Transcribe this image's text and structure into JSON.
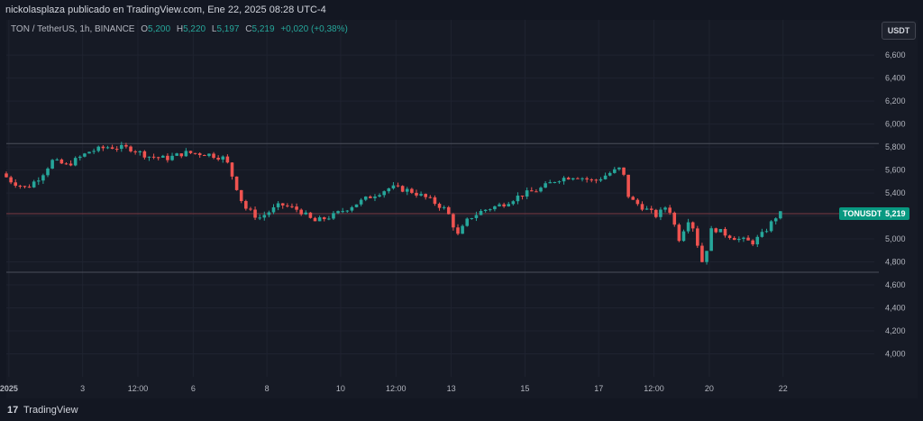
{
  "header": {
    "publisher_line": "nickolasplaza publicado en TradingView.com, Ene 22, 2025 08:28 UTC-4"
  },
  "legend": {
    "symbol": "TON / TetherUS, 1h, BINANCE",
    "open_label": "O",
    "open_value": "5,200",
    "high_label": "H",
    "high_value": "5,220",
    "low_label": "L",
    "low_value": "5,197",
    "close_label": "C",
    "close_value": "5,219",
    "change": "+0,020 (+0,38%)"
  },
  "toolbar": {
    "currency": "USDT"
  },
  "price_tag": {
    "symbol": "TONUSDT",
    "value": "5,219"
  },
  "footer": {
    "logo_text": "17",
    "brand": "TradingView"
  },
  "colors": {
    "up": "#26a69a",
    "down": "#ef5350",
    "background": "#161a25",
    "grid": "#1f2330",
    "axis_text": "#b2b5be",
    "tag": "#089981"
  },
  "chart_data": {
    "type": "candlestick",
    "y_ticks": [
      4.0,
      4.2,
      4.4,
      4.6,
      4.8,
      5.0,
      5.2,
      5.4,
      5.6,
      5.8,
      6.0,
      6.2,
      6.4,
      6.6
    ],
    "y_tick_labels": [
      "4,000",
      "4,200",
      "4,400",
      "4,600",
      "4,800",
      "5,000",
      "5,200",
      "5,400",
      "5,600",
      "5,800",
      "6,000",
      "6,200",
      "6,400",
      "6,600"
    ],
    "ylim": [
      3.8,
      6.75
    ],
    "x_ticks": [
      {
        "label": "2025",
        "day": 1.0
      },
      {
        "label": "3",
        "day": 3.0
      },
      {
        "label": "12:00",
        "day": 4.5
      },
      {
        "label": "6",
        "day": 6.0
      },
      {
        "label": "8",
        "day": 8.0
      },
      {
        "label": "10",
        "day": 10.0
      },
      {
        "label": "12:00",
        "day": 11.5
      },
      {
        "label": "13",
        "day": 13.0
      },
      {
        "label": "15",
        "day": 15.0
      },
      {
        "label": "17",
        "day": 17.0
      },
      {
        "label": "12:00",
        "day": 18.5
      },
      {
        "label": "20",
        "day": 20.0
      },
      {
        "label": "22",
        "day": 22.0
      }
    ],
    "xlim": [
      0.93,
      23.45
    ],
    "horizontal_lines": [
      5.83,
      5.22,
      4.71
    ],
    "current_price": 5.219,
    "path_keypoints": [
      [
        0.93,
        5.57
      ],
      [
        1.2,
        5.5
      ],
      [
        1.6,
        5.44
      ],
      [
        2.0,
        5.55
      ],
      [
        2.3,
        5.68
      ],
      [
        2.7,
        5.64
      ],
      [
        3.3,
        5.76
      ],
      [
        3.8,
        5.8
      ],
      [
        4.4,
        5.79
      ],
      [
        4.9,
        5.72
      ],
      [
        5.4,
        5.7
      ],
      [
        5.9,
        5.75
      ],
      [
        6.5,
        5.74
      ],
      [
        7.0,
        5.7
      ],
      [
        7.3,
        5.45
      ],
      [
        7.5,
        5.28
      ],
      [
        7.9,
        5.18
      ],
      [
        8.5,
        5.3
      ],
      [
        9.0,
        5.25
      ],
      [
        9.4,
        5.15
      ],
      [
        9.9,
        5.2
      ],
      [
        10.5,
        5.3
      ],
      [
        11.0,
        5.38
      ],
      [
        11.5,
        5.45
      ],
      [
        12.0,
        5.42
      ],
      [
        12.5,
        5.35
      ],
      [
        13.0,
        5.25
      ],
      [
        13.3,
        5.03
      ],
      [
        13.6,
        5.18
      ],
      [
        14.0,
        5.25
      ],
      [
        14.5,
        5.3
      ],
      [
        15.0,
        5.38
      ],
      [
        15.5,
        5.43
      ],
      [
        16.0,
        5.52
      ],
      [
        16.5,
        5.55
      ],
      [
        17.0,
        5.5
      ],
      [
        17.4,
        5.57
      ],
      [
        17.75,
        5.62
      ],
      [
        17.95,
        5.35
      ],
      [
        18.3,
        5.28
      ],
      [
        18.7,
        5.2
      ],
      [
        19.0,
        5.3
      ],
      [
        19.3,
        5.0
      ],
      [
        19.6,
        5.2
      ],
      [
        19.95,
        4.78
      ],
      [
        20.2,
        5.1
      ],
      [
        20.5,
        5.05
      ],
      [
        20.9,
        5.0
      ],
      [
        21.3,
        4.97
      ],
      [
        21.6,
        5.05
      ],
      [
        21.9,
        5.18
      ],
      [
        22.0,
        5.219
      ]
    ],
    "candles_per_day": 8
  }
}
